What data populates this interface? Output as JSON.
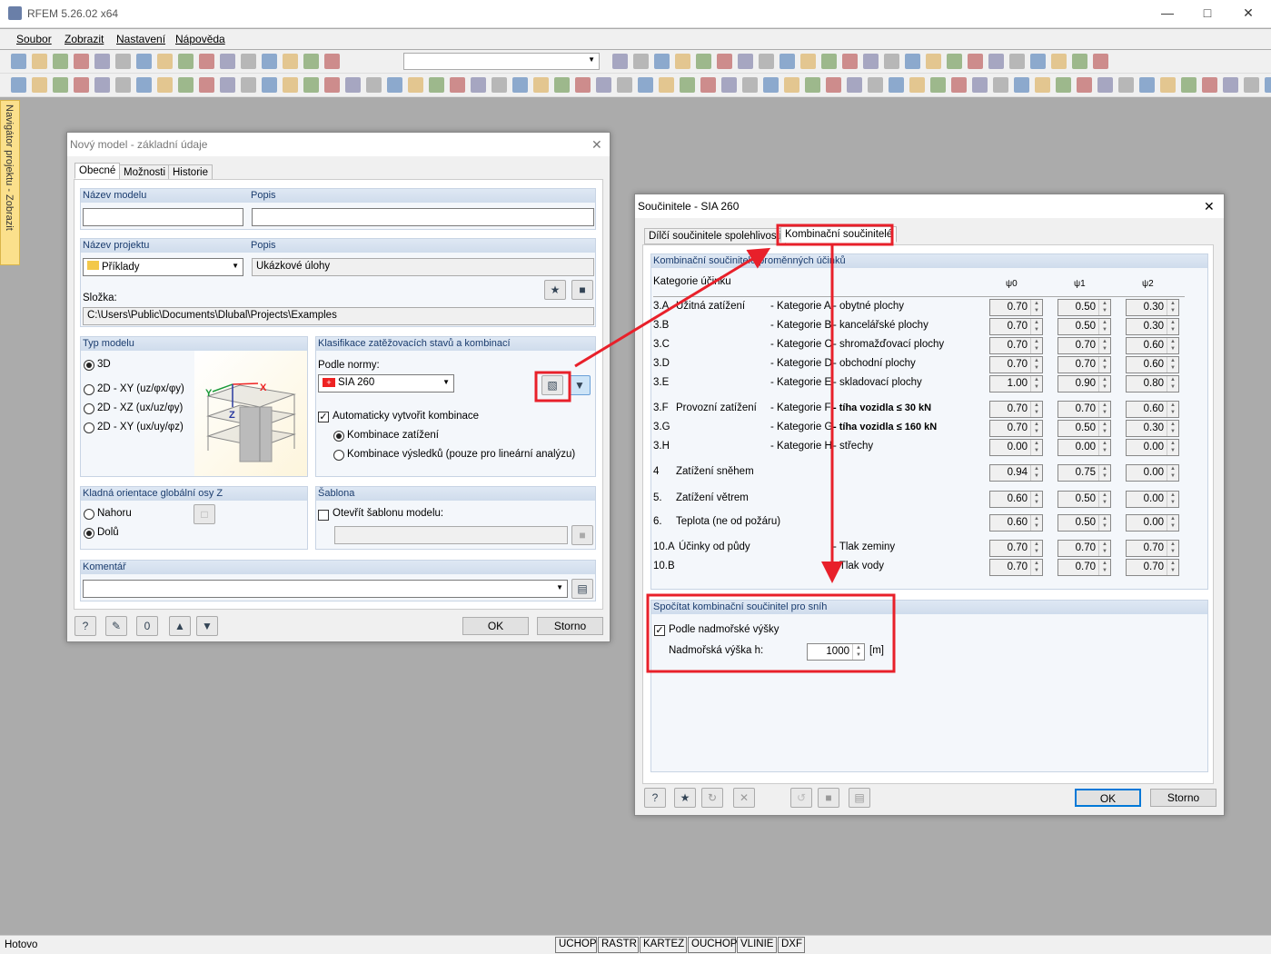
{
  "app": {
    "title": "RFEM 5.26.02 x64",
    "window_controls": [
      "minimize",
      "maximize",
      "close"
    ]
  },
  "menu": [
    "Soubor",
    "Zobrazit",
    "Nastavení",
    "Nápověda"
  ],
  "navigator_tab": "Navigátor projektu - Zobrazit",
  "status": {
    "text": "Hotovo",
    "buttons": [
      "UCHOP",
      "RASTR",
      "KARTEZ",
      "OUCHOP",
      "VLINIE",
      "DXF"
    ]
  },
  "dialog1": {
    "title": "Nový model - základní údaje",
    "tabs": [
      "Obecné",
      "Možnosti",
      "Historie"
    ],
    "model_name_label": "Název modelu",
    "model_name": "",
    "desc_label": "Popis",
    "desc": "",
    "project_label": "Název projektu",
    "project": "Příklady",
    "project_desc_label": "Popis",
    "project_desc": "Ukázkové úlohy",
    "folder_label": "Složka:",
    "folder": "C:\\Users\\Public\\Documents\\Dlubal\\Projects\\Examples",
    "model_type": {
      "header": "Typ modelu",
      "options": [
        "3D",
        "2D - XY (uz/φx/φy)",
        "2D - XZ (ux/uz/φy)",
        "2D - XY (ux/uy/φz)"
      ],
      "selected": 0,
      "axis_labels": [
        "X",
        "Y",
        "Z"
      ]
    },
    "classification": {
      "header": "Klasifikace zatěžovacích stavů a kombinací",
      "norm_label": "Podle normy:",
      "norm": "SIA 260",
      "auto_label": "Automaticky vytvořit kombinace",
      "auto_checked": true,
      "options": [
        "Kombinace zatížení",
        "Kombinace výsledků (pouze pro lineární analýzu)"
      ],
      "selected": 0
    },
    "orientation": {
      "header": "Kladná orientace globální osy Z",
      "options": [
        "Nahoru",
        "Dolů"
      ],
      "selected": 1
    },
    "template": {
      "header": "Šablona",
      "open_label": "Otevřít šablonu modelu:",
      "checked": false,
      "value": ""
    },
    "comment": {
      "header": "Komentář",
      "value": ""
    },
    "ok": "OK",
    "cancel": "Storno"
  },
  "dialog2": {
    "title": "Součinitele - SIA 260",
    "tabs": [
      "Dílčí součinitele spolehlivosti",
      "Kombinační součinitelé"
    ],
    "group_header": "Kombinační součinitelé proměnných účinků",
    "category_label": "Kategorie účinku",
    "columns": [
      "ψ0",
      "ψ1",
      "ψ2"
    ],
    "rows": [
      {
        "id": "3.A",
        "name": "Užitná zatížení",
        "cat": "- Kategorie A",
        "desc": "- obytné plochy",
        "v": [
          "0.70",
          "0.50",
          "0.30"
        ]
      },
      {
        "id": "3.B",
        "name": "",
        "cat": "- Kategorie B",
        "desc": "- kancelářské plochy",
        "v": [
          "0.70",
          "0.50",
          "0.30"
        ]
      },
      {
        "id": "3.C",
        "name": "",
        "cat": "- Kategorie C",
        "desc": "- shromažďovací plochy",
        "v": [
          "0.70",
          "0.70",
          "0.60"
        ]
      },
      {
        "id": "3.D",
        "name": "",
        "cat": "- Kategorie D",
        "desc": "- obchodní plochy",
        "v": [
          "0.70",
          "0.70",
          "0.60"
        ]
      },
      {
        "id": "3.E",
        "name": "",
        "cat": "- Kategorie E",
        "desc": "- skladovací plochy",
        "v": [
          "1.00",
          "0.90",
          "0.80"
        ]
      },
      {
        "id": "3.F",
        "name": "Provozní zatížení",
        "cat": "- Kategorie F",
        "desc": "- tíha vozidla ≤ 30 kN",
        "v": [
          "0.70",
          "0.70",
          "0.60"
        ]
      },
      {
        "id": "3.G",
        "name": "",
        "cat": "- Kategorie G",
        "desc": "- tíha vozidla ≤ 160 kN",
        "v": [
          "0.70",
          "0.50",
          "0.30"
        ]
      },
      {
        "id": "3.H",
        "name": "",
        "cat": "- Kategorie H",
        "desc": "- střechy",
        "v": [
          "0.00",
          "0.00",
          "0.00"
        ]
      },
      {
        "id": "4",
        "name": "Zatížení sněhem",
        "cat": "",
        "desc": "",
        "v": [
          "0.94",
          "0.75",
          "0.00"
        ]
      },
      {
        "id": "5.",
        "name": "Zatížení větrem",
        "cat": "",
        "desc": "",
        "v": [
          "0.60",
          "0.50",
          "0.00"
        ]
      },
      {
        "id": "6.",
        "name": "Teplota (ne od požáru)",
        "cat": "",
        "desc": "",
        "v": [
          "0.60",
          "0.50",
          "0.00"
        ]
      },
      {
        "id": "10.A",
        "name": "Účinky od půdy",
        "cat": "",
        "desc": "- Tlak zeminy",
        "v": [
          "0.70",
          "0.70",
          "0.70"
        ]
      },
      {
        "id": "10.B",
        "name": "",
        "cat": "",
        "desc": "- Tlak vody",
        "v": [
          "0.70",
          "0.70",
          "0.70"
        ]
      }
    ],
    "snow": {
      "header": "Spočítat kombinační součinitel pro sníh",
      "altitude_check": "Podle nadmořské výšky",
      "checked": true,
      "altitude_label": "Nadmořská výška h:",
      "altitude": "1000",
      "unit": "[m]"
    },
    "ok": "OK",
    "cancel": "Storno"
  },
  "colors": {
    "annotation": "#e8202a",
    "accent": "#0078d7"
  }
}
